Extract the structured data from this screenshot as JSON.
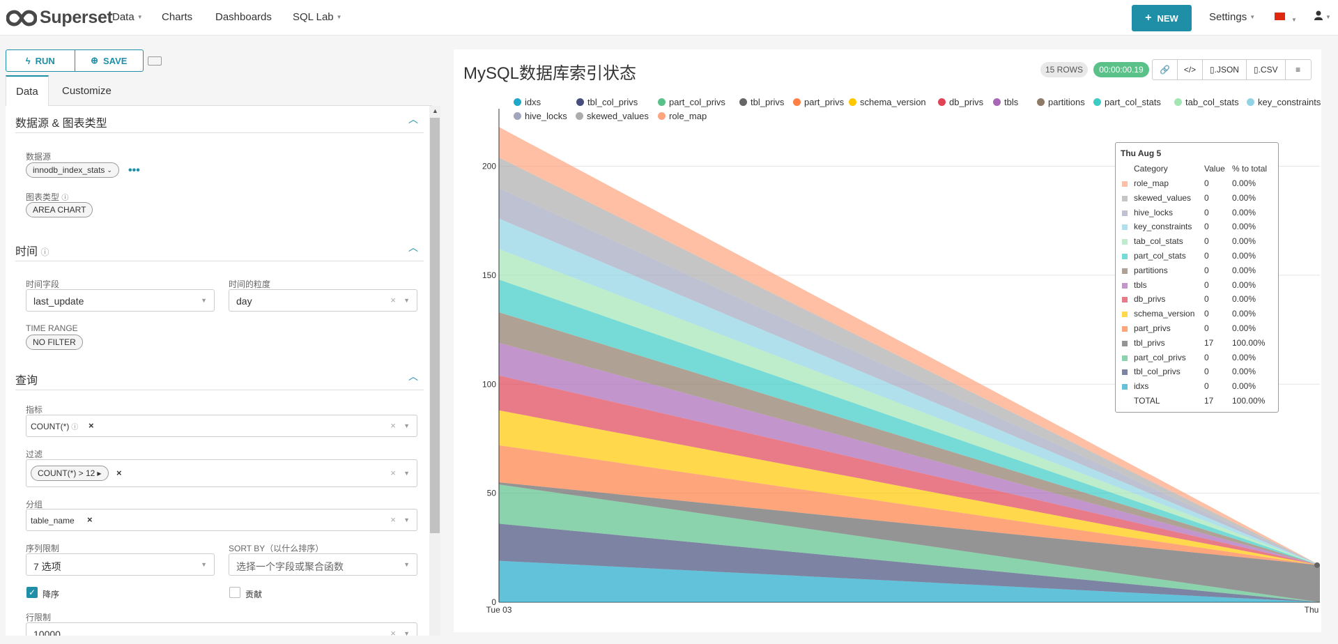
{
  "app": {
    "name": "Superset"
  },
  "nav": {
    "data": "Data",
    "charts": "Charts",
    "dashboards": "Dashboards",
    "sqllab": "SQL Lab",
    "new": "NEW",
    "settings": "Settings"
  },
  "toolbar": {
    "run": "RUN",
    "save": "SAVE"
  },
  "tabs": {
    "data": "Data",
    "customize": "Customize"
  },
  "sections": {
    "datasource": {
      "title": "数据源 & 图表类型",
      "datasource_label": "数据源",
      "datasource_value": "innodb_index_stats",
      "viz_label": "图表类型",
      "viz_value": "AREA CHART"
    },
    "time": {
      "title": "时间",
      "time_column_label": "时间字段",
      "time_column_value": "last_update",
      "grain_label": "时间的粒度",
      "grain_value": "day",
      "range_label": "TIME RANGE",
      "range_value": "NO FILTER"
    },
    "query": {
      "title": "查询",
      "metrics_label": "指标",
      "metric_value": "COUNT(*)",
      "filters_label": "过滤",
      "filter_value": "COUNT(*) > 12",
      "groupby_label": "分组",
      "groupby_value": "table_name",
      "series_limit_label": "序列限制",
      "series_limit_value": "7 选项",
      "sort_by_label": "SORT BY（以什么排序）",
      "sort_by_placeholder": "选择一个字段或聚合函数",
      "descending_label": "降序",
      "contribution_label": "贡献",
      "row_limit_label": "行限制",
      "row_limit_value": "10000"
    }
  },
  "chart_header": {
    "title": "MySQL数据库索引状态",
    "rows": "15 ROWS",
    "timer": "00:00:00.19",
    "json": ".JSON",
    "csv": ".CSV"
  },
  "chart_data": {
    "type": "area",
    "stacked": true,
    "x": [
      "Tue 03",
      "Thu"
    ],
    "ylim": [
      0,
      220
    ],
    "yticks": [
      0,
      50,
      100,
      150,
      200
    ],
    "series": [
      {
        "name": "idxs",
        "color": "#1fa8c9",
        "values": [
          19,
          0
        ]
      },
      {
        "name": "tbl_col_privs",
        "color": "#454e7c",
        "values": [
          17,
          0
        ]
      },
      {
        "name": "part_col_privs",
        "color": "#5ac189",
        "values": [
          18,
          0
        ]
      },
      {
        "name": "tbl_privs",
        "color": "#666666",
        "values": [
          1,
          17
        ]
      },
      {
        "name": "part_privs",
        "color": "#ff7f44",
        "values": [
          17,
          0
        ]
      },
      {
        "name": "schema_version",
        "color": "#ffc800",
        "values": [
          16,
          0
        ]
      },
      {
        "name": "db_privs",
        "color": "#e04355",
        "values": [
          16,
          0
        ]
      },
      {
        "name": "tbls",
        "color": "#a868b7",
        "values": [
          15,
          0
        ]
      },
      {
        "name": "partitions",
        "color": "#8d7a67",
        "values": [
          14,
          0
        ]
      },
      {
        "name": "part_col_stats",
        "color": "#3cccc4",
        "values": [
          15,
          0
        ]
      },
      {
        "name": "tab_col_stats",
        "color": "#a1e6b3",
        "values": [
          14,
          0
        ]
      },
      {
        "name": "key_constraints",
        "color": "#8fd3e4",
        "values": [
          14,
          0
        ]
      },
      {
        "name": "hive_locks",
        "color": "#a1a6bd",
        "values": [
          14,
          0
        ]
      },
      {
        "name": "skewed_values",
        "color": "#acacac",
        "values": [
          14,
          0
        ]
      },
      {
        "name": "role_map",
        "color": "#fea47e",
        "values": [
          14,
          0
        ]
      }
    ]
  },
  "tooltip": {
    "title": "Thu Aug 5",
    "headers": {
      "category": "Category",
      "value": "Value",
      "pct": "% to total"
    },
    "rows": [
      {
        "name": "role_map",
        "value": "0",
        "pct": "0.00%",
        "color": "#fea47e"
      },
      {
        "name": "skewed_values",
        "value": "0",
        "pct": "0.00%",
        "color": "#acacac"
      },
      {
        "name": "hive_locks",
        "value": "0",
        "pct": "0.00%",
        "color": "#a1a6bd"
      },
      {
        "name": "key_constraints",
        "value": "0",
        "pct": "0.00%",
        "color": "#8fd3e4"
      },
      {
        "name": "tab_col_stats",
        "value": "0",
        "pct": "0.00%",
        "color": "#a1e6b3"
      },
      {
        "name": "part_col_stats",
        "value": "0",
        "pct": "0.00%",
        "color": "#3cccc4"
      },
      {
        "name": "partitions",
        "value": "0",
        "pct": "0.00%",
        "color": "#8d7a67"
      },
      {
        "name": "tbls",
        "value": "0",
        "pct": "0.00%",
        "color": "#a868b7"
      },
      {
        "name": "db_privs",
        "value": "0",
        "pct": "0.00%",
        "color": "#e04355"
      },
      {
        "name": "schema_version",
        "value": "0",
        "pct": "0.00%",
        "color": "#ffc800"
      },
      {
        "name": "part_privs",
        "value": "0",
        "pct": "0.00%",
        "color": "#ff7f44"
      },
      {
        "name": "tbl_privs",
        "value": "17",
        "pct": "100.00%",
        "color": "#666666"
      },
      {
        "name": "part_col_privs",
        "value": "0",
        "pct": "0.00%",
        "color": "#5ac189"
      },
      {
        "name": "tbl_col_privs",
        "value": "0",
        "pct": "0.00%",
        "color": "#454e7c"
      },
      {
        "name": "idxs",
        "value": "0",
        "pct": "0.00%",
        "color": "#1fa8c9"
      }
    ],
    "total": {
      "name": "TOTAL",
      "value": "17",
      "pct": "100.00%"
    }
  }
}
